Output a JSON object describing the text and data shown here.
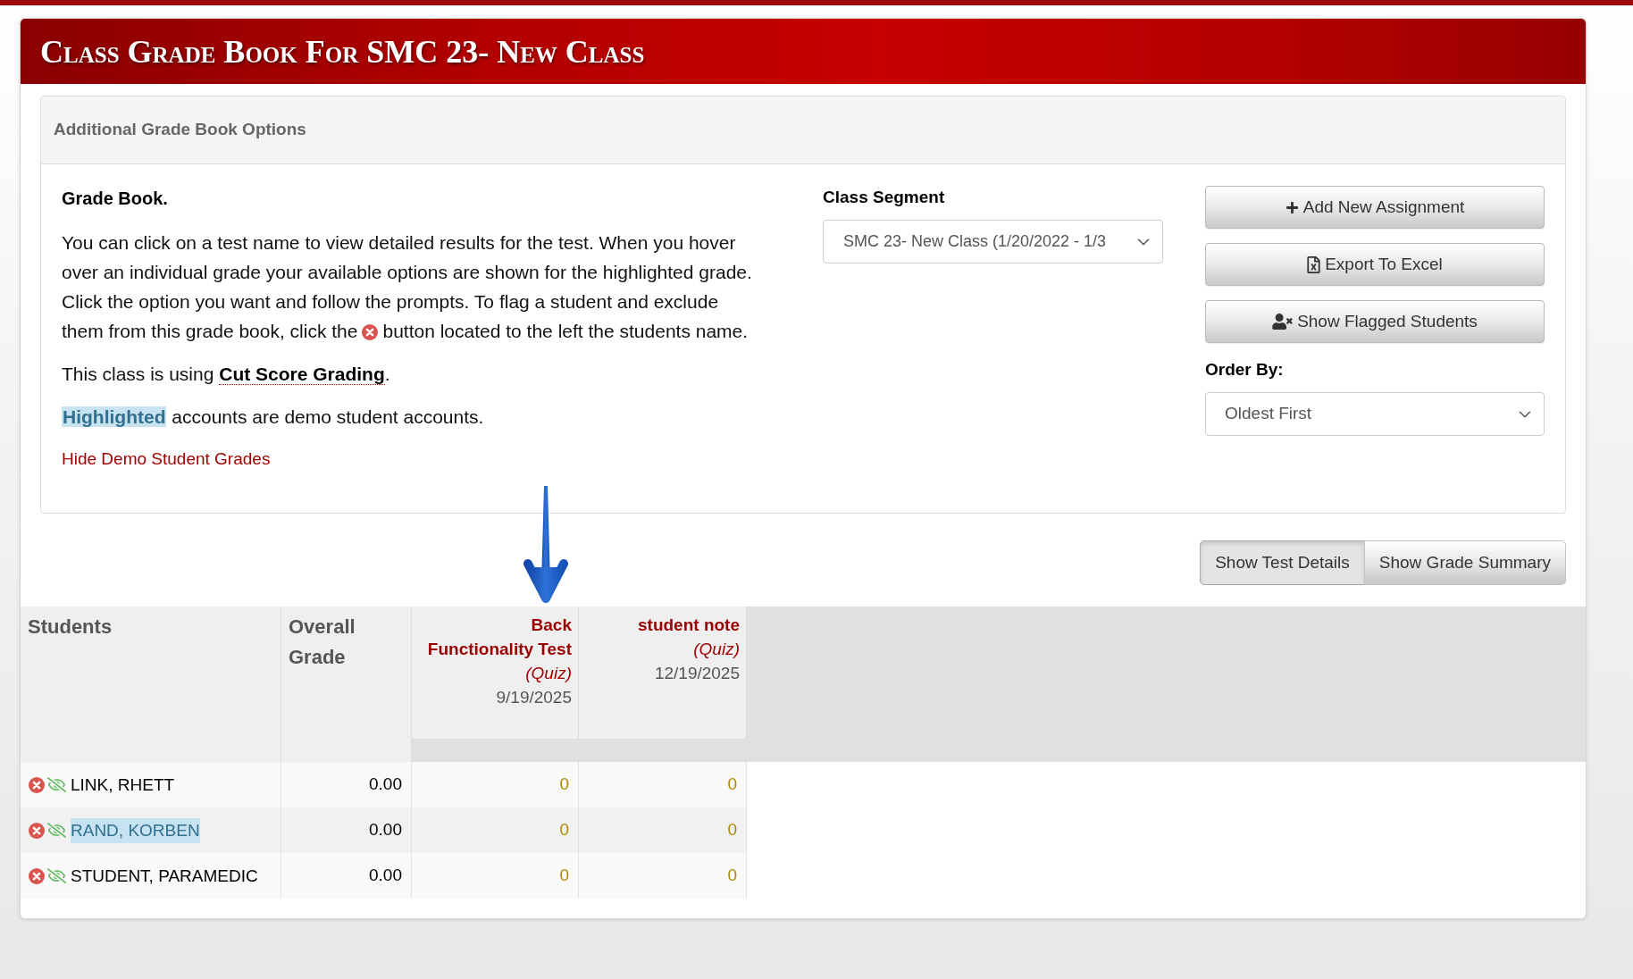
{
  "page_title": "Class Grade Book For SMC 23- New Class",
  "options_panel": {
    "heading": "Additional Grade Book Options",
    "intro_title": "Grade Book.",
    "instructions": {
      "text": "You can click on a test name to view detailed results for the test. When you hover over an individual grade your available options are shown for the highlighted grade. Click the option you want and follow the prompts. To flag a student and exclude",
      "text_before_icon": "them from this grade book, click the",
      "text_after_icon": "button located to the left the students name."
    },
    "grading_note": {
      "prefix": "This class is using",
      "method": "Cut Score Grading",
      "suffix": "."
    },
    "demo_note": {
      "highlight_sample": "Highlighted",
      "text": "accounts are demo student accounts."
    },
    "hide_demo_link": "Hide Demo Student Grades",
    "class_segment": {
      "label": "Class Segment",
      "value": "SMC 23- New Class (1/20/2022 - 1/3"
    },
    "actions": [
      {
        "kind": "add",
        "label": "Add New Assignment"
      },
      {
        "kind": "export",
        "label": "Export To Excel"
      },
      {
        "kind": "flagged",
        "label": "Show Flagged Students"
      }
    ],
    "order_by": {
      "label": "Order By:",
      "value": "Oldest First"
    }
  },
  "view_toggle": [
    {
      "label": "Show Test Details",
      "selected": true
    },
    {
      "label": "Show Grade Summary",
      "selected": false
    }
  ],
  "table": {
    "columns": {
      "students": "Students",
      "overall_grade": "Overall Grade"
    },
    "assignments": [
      {
        "title": "Back Functionality Test",
        "type": "(Quiz)",
        "date": "9/19/2025"
      },
      {
        "title": "student note",
        "type": "(Quiz)",
        "date": "12/19/2025"
      }
    ],
    "rows": [
      {
        "name": "LINK, RHETT",
        "demo": false,
        "overall_grade": "0.00",
        "scores": [
          "0",
          "0"
        ]
      },
      {
        "name": "RAND, KORBEN",
        "demo": true,
        "overall_grade": "0.00",
        "scores": [
          "0",
          "0"
        ]
      },
      {
        "name": "STUDENT, PARAMEDIC",
        "demo": false,
        "overall_grade": "0.00",
        "scores": [
          "0",
          "0"
        ]
      }
    ]
  }
}
